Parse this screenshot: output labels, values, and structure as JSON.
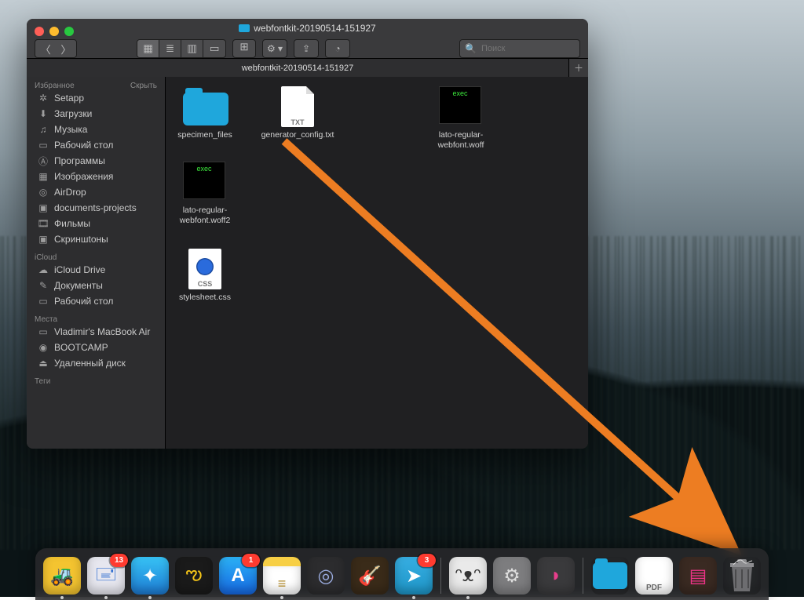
{
  "window": {
    "title": "webfontkit-20190514-151927",
    "tab_label": "webfontkit-20190514-151927",
    "search_placeholder": "Поиск"
  },
  "sidebar": {
    "sections": [
      {
        "title": "Избранное",
        "action": "Скрыть",
        "items": [
          {
            "icon": "grid",
            "label": "Setapp"
          },
          {
            "icon": "download",
            "label": "Загрузки"
          },
          {
            "icon": "music",
            "label": "Музыка"
          },
          {
            "icon": "desktop",
            "label": "Рабочий стол"
          },
          {
            "icon": "apps",
            "label": "Программы"
          },
          {
            "icon": "images",
            "label": "Изображения"
          },
          {
            "icon": "airdrop",
            "label": "AirDrop"
          },
          {
            "icon": "folder",
            "label": "documents-projects"
          },
          {
            "icon": "film",
            "label": "Фильмы"
          },
          {
            "icon": "folder",
            "label": "Скриншtоны"
          }
        ]
      },
      {
        "title": "iCloud",
        "action": "",
        "items": [
          {
            "icon": "cloud",
            "label": "iCloud Drive"
          },
          {
            "icon": "docs",
            "label": "Документы"
          },
          {
            "icon": "desktop",
            "label": "Рабочий стол"
          }
        ]
      },
      {
        "title": "Места",
        "action": "",
        "items": [
          {
            "icon": "laptop",
            "label": "Vladimir's MacBook Air"
          },
          {
            "icon": "disk",
            "label": "BOOTCAMP"
          },
          {
            "icon": "eject",
            "label": "Удаленный диск"
          }
        ]
      },
      {
        "title": "Теги",
        "action": "",
        "items": []
      }
    ]
  },
  "files": [
    {
      "kind": "folder",
      "name": "specimen_files"
    },
    {
      "kind": "txt",
      "name": "generator_config.txt",
      "badge": "TXT"
    },
    {
      "kind": "exec",
      "name": "lato-regular-webfont.woff",
      "badge": "exec"
    },
    {
      "kind": "exec",
      "name": "lato-regular-webfont.woff2",
      "badge": "exec"
    },
    {
      "kind": "css",
      "name": "stylesheet.css",
      "badge": "CSS"
    }
  ],
  "dock": {
    "items": [
      {
        "id": "forklift",
        "label": "ForkLift",
        "running": true
      },
      {
        "id": "mail",
        "label": "Mail",
        "badge": "13",
        "running": true
      },
      {
        "id": "safari",
        "label": "Safari",
        "running": true
      },
      {
        "id": "butterfly",
        "label": "Ulysses",
        "running": false
      },
      {
        "id": "appstore",
        "label": "App Store",
        "badge": "1",
        "running": false
      },
      {
        "id": "notes",
        "label": "Notes",
        "running": true
      },
      {
        "id": "logic",
        "label": "Logic",
        "running": false
      },
      {
        "id": "garageband",
        "label": "GarageBand",
        "running": false
      },
      {
        "id": "telegram",
        "label": "Telegram",
        "badge": "3",
        "running": true
      }
    ],
    "items2": [
      {
        "id": "bear",
        "label": "Bear",
        "running": true
      },
      {
        "id": "settings",
        "label": "System Preferences",
        "running": false
      },
      {
        "id": "clean",
        "label": "CleanMyMac",
        "running": false
      }
    ],
    "items3": [
      {
        "id": "folder",
        "label": "Downloads"
      },
      {
        "id": "pdf",
        "label": "PDF",
        "text": "PDF"
      },
      {
        "id": "stack",
        "label": "Recent"
      },
      {
        "id": "trash",
        "label": "Trash"
      }
    ]
  },
  "annotation": {
    "color": "#ed7d22"
  }
}
